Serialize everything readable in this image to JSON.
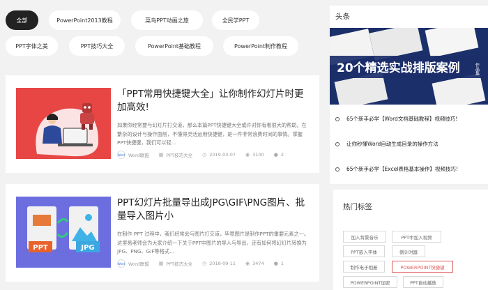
{
  "categories": [
    {
      "label": "全部",
      "active": true
    },
    {
      "label": "PowerPoint2013教程"
    },
    {
      "label": "菜鸟PPT动画之旅"
    },
    {
      "label": "全民学PPT"
    },
    {
      "label": "PPT字体之美"
    },
    {
      "label": "PPT技巧大全"
    },
    {
      "label": "PowerPoint基础教程"
    },
    {
      "label": "PowerPoint制作教程"
    }
  ],
  "articles": [
    {
      "title": "「PPT常用快捷键大全」让你制作幻灯片时更加高效!",
      "excerpt": "如果你经常要与幻灯片打交道，那么本篇PPT快捷键大全或许对你有着很大的帮助。在繁杂的设计与操作面前，不懂得灵活运用快捷键，是一件非常浪费时间的事情。掌握PPT快捷键，我们可以轻...",
      "author": "Word联盟",
      "category": "PPT技巧大全",
      "date": "2019-03-07",
      "views": "3100",
      "comments": "2"
    },
    {
      "title": "PPT幻灯片批量导出成JPG\\GIF\\PNG图片、批量导入图片小",
      "excerpt": "在制作 PPT 过程中，我们经常会与图片打交道，毕竟图片是制作PPT的重要元素之一。这里易老师会为大家介绍一下关于PPT中图片的导入与导出，还有如何将幻灯片转换为JPG、PNG、GIF等格式...",
      "author": "Word联盟",
      "category": "PPT技巧大全",
      "date": "2018-09-11",
      "views": "3474",
      "comments": "1",
      "thumb_left": "PPT",
      "thumb_right": "JPG"
    }
  ],
  "meta_logo": "Word",
  "sidebar": {
    "headlines_title": "头条",
    "banner_text": "20个精选实战排版案例",
    "banner_side": "作品集",
    "headlines": [
      "65个新手必学【Word文档基础教程】视频技巧!",
      "让你秒懂Word自动生成目录的操作方法",
      "65个新手必学【Excel表格基本操作】视频技巧!"
    ],
    "tags_title": "热门标签",
    "tags": [
      {
        "label": "加入背景音乐"
      },
      {
        "label": "PPT中加入视频"
      },
      {
        "label": "PPT嵌入字体"
      },
      {
        "label": "倒计时器"
      },
      {
        "label": "制作电子相册"
      },
      {
        "label": "POWERPOINT快捷键",
        "hot": true
      },
      {
        "label": "POWERPOINT加密"
      },
      {
        "label": "PPT自动播放"
      }
    ]
  },
  "colors": {
    "active_pill": "#222222",
    "hot_tag": "#e05a5a",
    "banner_bg": "#1b2f6a",
    "thumb1_bg": "#e84545",
    "thumb2_bg": "#6c6ee0"
  }
}
